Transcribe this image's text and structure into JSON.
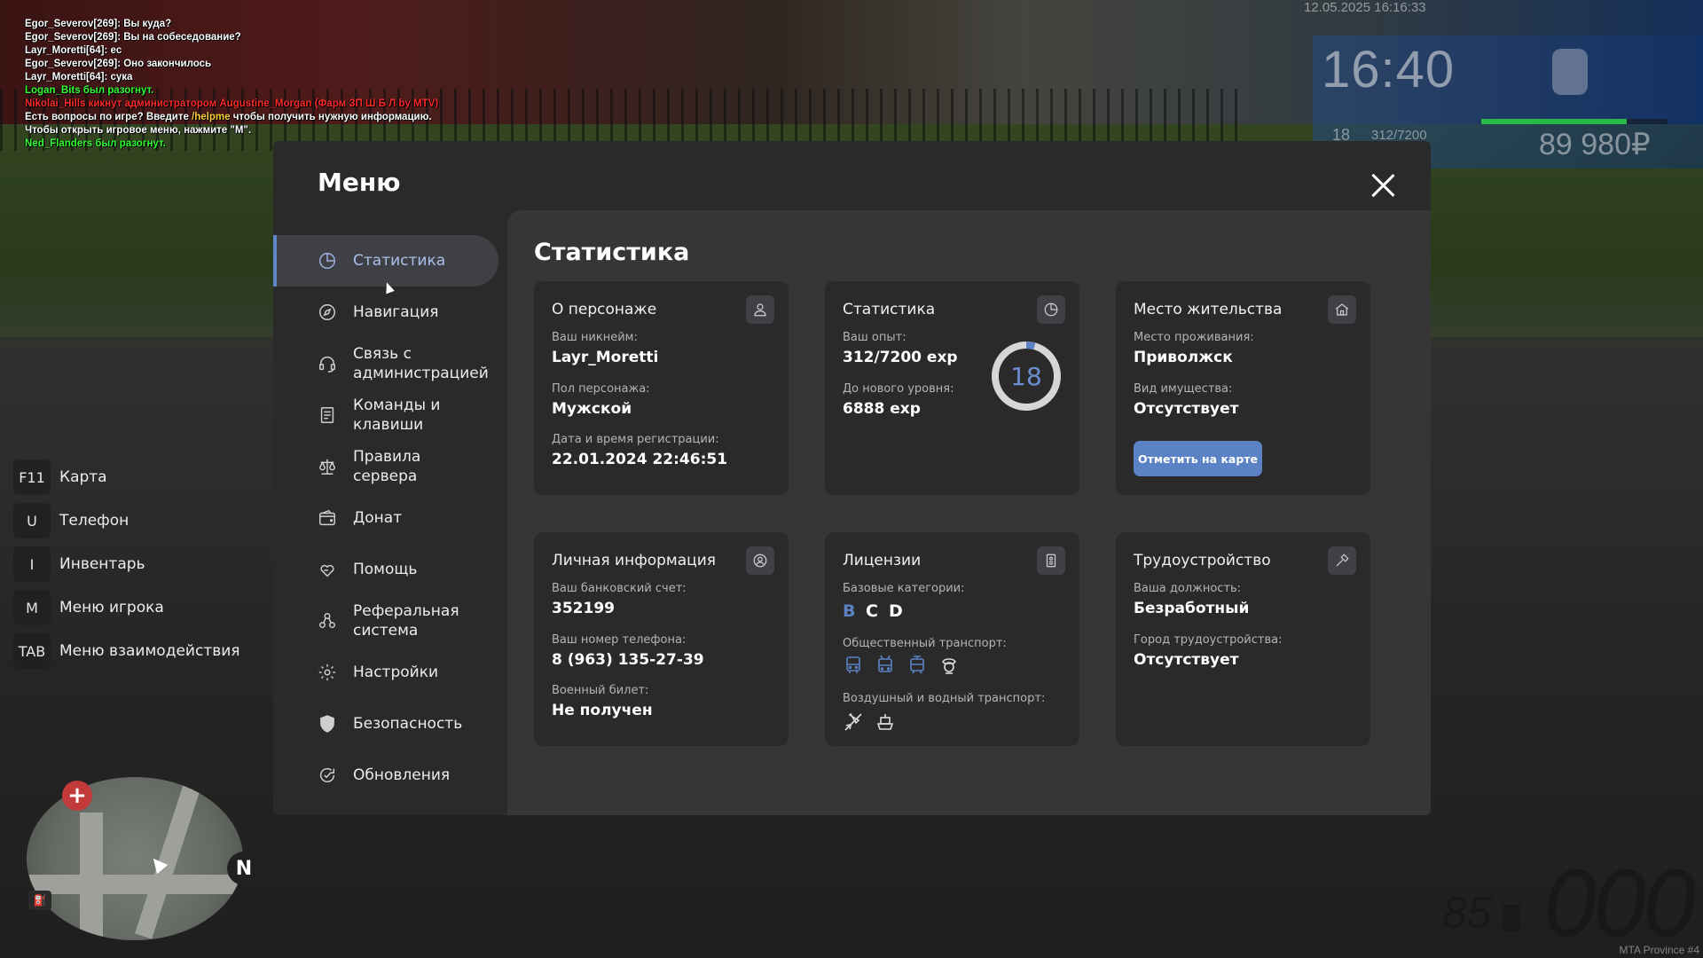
{
  "chat": [
    {
      "text": "Egor_Severov[269]: Вы куда?",
      "color": "white"
    },
    {
      "text": "Egor_Severov[269]: Вы на собеседование?",
      "color": "white"
    },
    {
      "text": "Layr_Moretti[64]: ec",
      "color": "white"
    },
    {
      "text": "Egor_Severov[269]: Оно закончилось",
      "color": "white"
    },
    {
      "text": "Layr_Moretti[64]: сука",
      "color": "white"
    },
    {
      "text": "Logan_Bits был разогнут.",
      "color": "green"
    },
    {
      "text": "Nikolai_Hills кикнут администратором Augustine_Morgan (Фарм ЗП Ш Б Л by MTV)",
      "color": "red"
    },
    {
      "text": "Есть вопросы по игре? Введите ",
      "color": "white",
      "highlight": "/helpme",
      "after": " чтобы получить нужную информацию."
    },
    {
      "text": "Чтобы открыть игровое меню, нажмите \"M\".",
      "color": "white"
    },
    {
      "text": "Ned_Flanders был разогнут.",
      "color": "green"
    }
  ],
  "hud": {
    "date": "12.05.2025 16:16:33",
    "time": "16:40",
    "level": "18",
    "exp": "312/7200",
    "exp_fraction": 0.78,
    "money": "89 980₽",
    "server": "MTA Province #4",
    "speed": "000",
    "fuel": "85"
  },
  "keyhints": [
    {
      "key": "F11",
      "label": "Карта"
    },
    {
      "key": "U",
      "label": "Телефон"
    },
    {
      "key": "I",
      "label": "Инвентарь"
    },
    {
      "key": "M",
      "label": "Меню игрока"
    },
    {
      "key": "TAB",
      "label": "Меню взаимодействия"
    }
  ],
  "minimap": {
    "north": "N",
    "hospital": "+"
  },
  "menu": {
    "title": "Меню",
    "nav": [
      {
        "label": "Статистика",
        "icon": "pie-chart-icon",
        "active": true
      },
      {
        "label": "Навигация",
        "icon": "compass-icon"
      },
      {
        "label": "Связь с администрацией",
        "icon": "headset-icon"
      },
      {
        "label": "Команды и клавиши",
        "icon": "document-icon"
      },
      {
        "label": "Правила сервера",
        "icon": "scales-icon"
      },
      {
        "label": "Донат",
        "icon": "wallet-icon"
      },
      {
        "label": "Помощь",
        "icon": "heart-hand-icon"
      },
      {
        "label": "Реферальная система",
        "icon": "people-icon"
      },
      {
        "label": "Настройки",
        "icon": "gear-icon"
      },
      {
        "label": "Безопасность",
        "icon": "shield-icon"
      },
      {
        "label": "Обновления",
        "icon": "refresh-check-icon"
      }
    ],
    "content_title": "Статистика",
    "cards": {
      "character": {
        "title": "О персонаже",
        "nickname_label": "Ваш никнейм:",
        "nickname": "Layr_Moretti",
        "gender_label": "Пол персонажа:",
        "gender": "Мужской",
        "reg_label": "Дата и время регистрации:",
        "reg": "22.01.2024 22:46:51"
      },
      "stats": {
        "title": "Статистика",
        "exp_label": "Ваш опыт:",
        "exp": "312/7200 exp",
        "next_label": "До нового уровня:",
        "next": "6888 exp",
        "level": "18",
        "level_progress": 0.043
      },
      "residence": {
        "title": "Место жительства",
        "place_label": "Место проживания:",
        "place": "Приволжск",
        "property_label": "Вид имущества:",
        "property": "Отсутствует",
        "button": "Отметить на карте"
      },
      "personal": {
        "title": "Личная информация",
        "bank_label": "Ваш банковский счет:",
        "bank": "352199",
        "phone_label": "Ваш номер телефона:",
        "phone": "8 (963) 135-27-39",
        "military_label": "Военный билет:",
        "military": "Не получен"
      },
      "licenses": {
        "title": "Лицензии",
        "base_label": "Базовые категории:",
        "categories": [
          {
            "letter": "B",
            "color": "#5b82c4"
          },
          {
            "letter": "C",
            "color": "#ffffff"
          },
          {
            "letter": "D",
            "color": "#ffffff"
          }
        ],
        "public_label": "Общественный транспорт:",
        "air_label": "Воздушный и водный транспорт:"
      },
      "job": {
        "title": "Трудоустройство",
        "position_label": "Ваша должность:",
        "position": "Безработный",
        "city_label": "Город трудоустройства:",
        "city": "Отсутствует"
      }
    }
  },
  "colors": {
    "accent": "#5b82c4",
    "panel": "#2a2a2b",
    "content": "#363637"
  }
}
